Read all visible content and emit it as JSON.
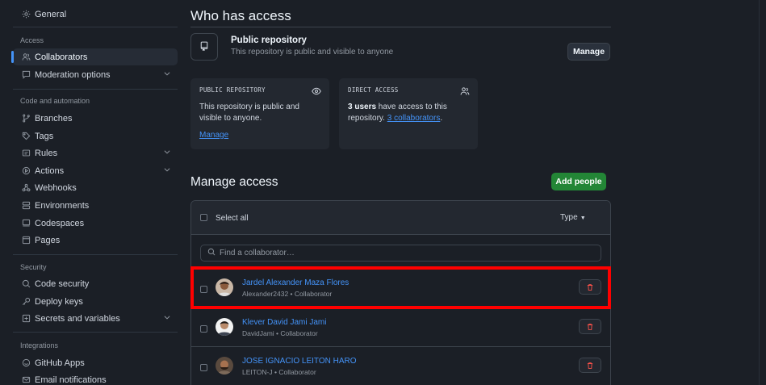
{
  "sidebar": {
    "general": "General",
    "sections": {
      "access": "Access",
      "code": "Code and automation",
      "security": "Security",
      "integrations": "Integrations"
    },
    "items": {
      "collaborators": "Collaborators",
      "moderation": "Moderation options",
      "branches": "Branches",
      "tags": "Tags",
      "rules": "Rules",
      "actions": "Actions",
      "webhooks": "Webhooks",
      "environments": "Environments",
      "codespaces": "Codespaces",
      "pages": "Pages",
      "code_security": "Code security",
      "deploy_keys": "Deploy keys",
      "secrets": "Secrets and variables",
      "github_apps": "GitHub Apps",
      "email": "Email notifications"
    }
  },
  "access": {
    "title": "Who has access",
    "public_title": "Public repository",
    "public_sub": "This repository is public and visible to anyone",
    "manage_label": "Manage",
    "card_public": {
      "heading": "PUBLIC REPOSITORY",
      "text": "This repository is public and visible to anyone.",
      "link": "Manage"
    },
    "card_direct": {
      "heading": "DIRECT ACCESS",
      "count": "3 users",
      "text_mid": " have access to this repository. ",
      "link": "3 collaborators",
      "text_end": "."
    }
  },
  "manage": {
    "title": "Manage access",
    "add_label": "Add people",
    "select_all": "Select all",
    "type_label": "Type",
    "search_placeholder": "Find a collaborator…",
    "collaborators": [
      {
        "name": "Jardel Alexander Maza Flores",
        "username": "Alexander2432",
        "role": "Collaborator"
      },
      {
        "name": "Klever David Jami Jami",
        "username": "DavidJami",
        "role": "Collaborator"
      },
      {
        "name": "JOSE IGNACIO LEITON HARO",
        "username": "LEITON-J",
        "role": "Collaborator"
      }
    ],
    "separator": " • "
  },
  "colors": {
    "accent": "#4493f8",
    "success": "#238636",
    "danger": "#f85149",
    "highlight": "#ff0000"
  }
}
